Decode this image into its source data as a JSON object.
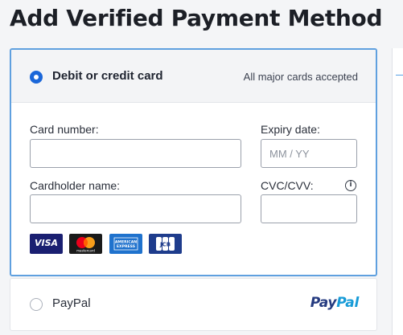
{
  "page": {
    "title": "Add Verified Payment Method"
  },
  "card_option": {
    "label": "Debit or credit card",
    "note": "All major cards accepted",
    "selected": true,
    "fields": {
      "card_number": {
        "label": "Card number:",
        "value": "",
        "placeholder": ""
      },
      "expiry": {
        "label": "Expiry date:",
        "value": "",
        "placeholder": "MM / YY"
      },
      "cardholder": {
        "label": "Cardholder name:",
        "value": "",
        "placeholder": ""
      },
      "cvc": {
        "label": "CVC/CVV:",
        "value": "",
        "placeholder": ""
      }
    },
    "info_icon_glyph": "i",
    "brands": {
      "visa": "VISA",
      "mastercard": "mastercard",
      "amex_line1": "AMERICAN",
      "amex_line2": "EXPRESS",
      "jcb": "JCB"
    }
  },
  "paypal_option": {
    "label": "PayPal",
    "selected": false,
    "logo_pay": "Pay",
    "logo_pal": "Pal"
  },
  "colors": {
    "accent_border": "#5fa0df",
    "radio_selected": "#1b67d9",
    "paypal_dark": "#253b80",
    "paypal_light": "#179bd7"
  }
}
